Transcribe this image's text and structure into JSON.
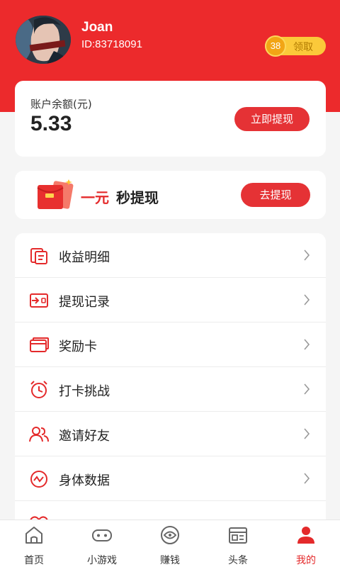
{
  "theme": {
    "primary": "#ec2a2c",
    "accent": "#fbc93a",
    "text": "#222222"
  },
  "profile": {
    "name": "Joan",
    "id_text": "ID:83718091",
    "avatar": "user-avatar"
  },
  "coins": {
    "count": "38",
    "label": "领取",
    "icon": "coin-icon"
  },
  "balance": {
    "label": "账户余额(元)",
    "amount": "5.33",
    "button": "立即提现"
  },
  "promo": {
    "highlight": "一元",
    "text": "秒提现",
    "button": "去提现",
    "icon": "red-envelope-icon"
  },
  "menu": [
    {
      "label": "收益明细",
      "icon": "income-detail-icon"
    },
    {
      "label": "提现记录",
      "icon": "withdraw-record-icon"
    },
    {
      "label": "奖励卡",
      "icon": "reward-card-icon"
    },
    {
      "label": "打卡挑战",
      "icon": "alarm-clock-icon"
    },
    {
      "label": "邀请好友",
      "icon": "invite-friends-icon"
    },
    {
      "label": "身体数据",
      "icon": "body-data-icon"
    },
    {
      "label": "",
      "icon": "heart-icon"
    }
  ],
  "tabs": [
    {
      "label": "首页",
      "icon": "home-icon",
      "active": false
    },
    {
      "label": "小游戏",
      "icon": "gamepad-icon",
      "active": false
    },
    {
      "label": "赚钱",
      "icon": "eye-icon",
      "active": false
    },
    {
      "label": "头条",
      "icon": "news-icon",
      "active": false
    },
    {
      "label": "我的",
      "icon": "profile-icon",
      "active": true
    }
  ]
}
